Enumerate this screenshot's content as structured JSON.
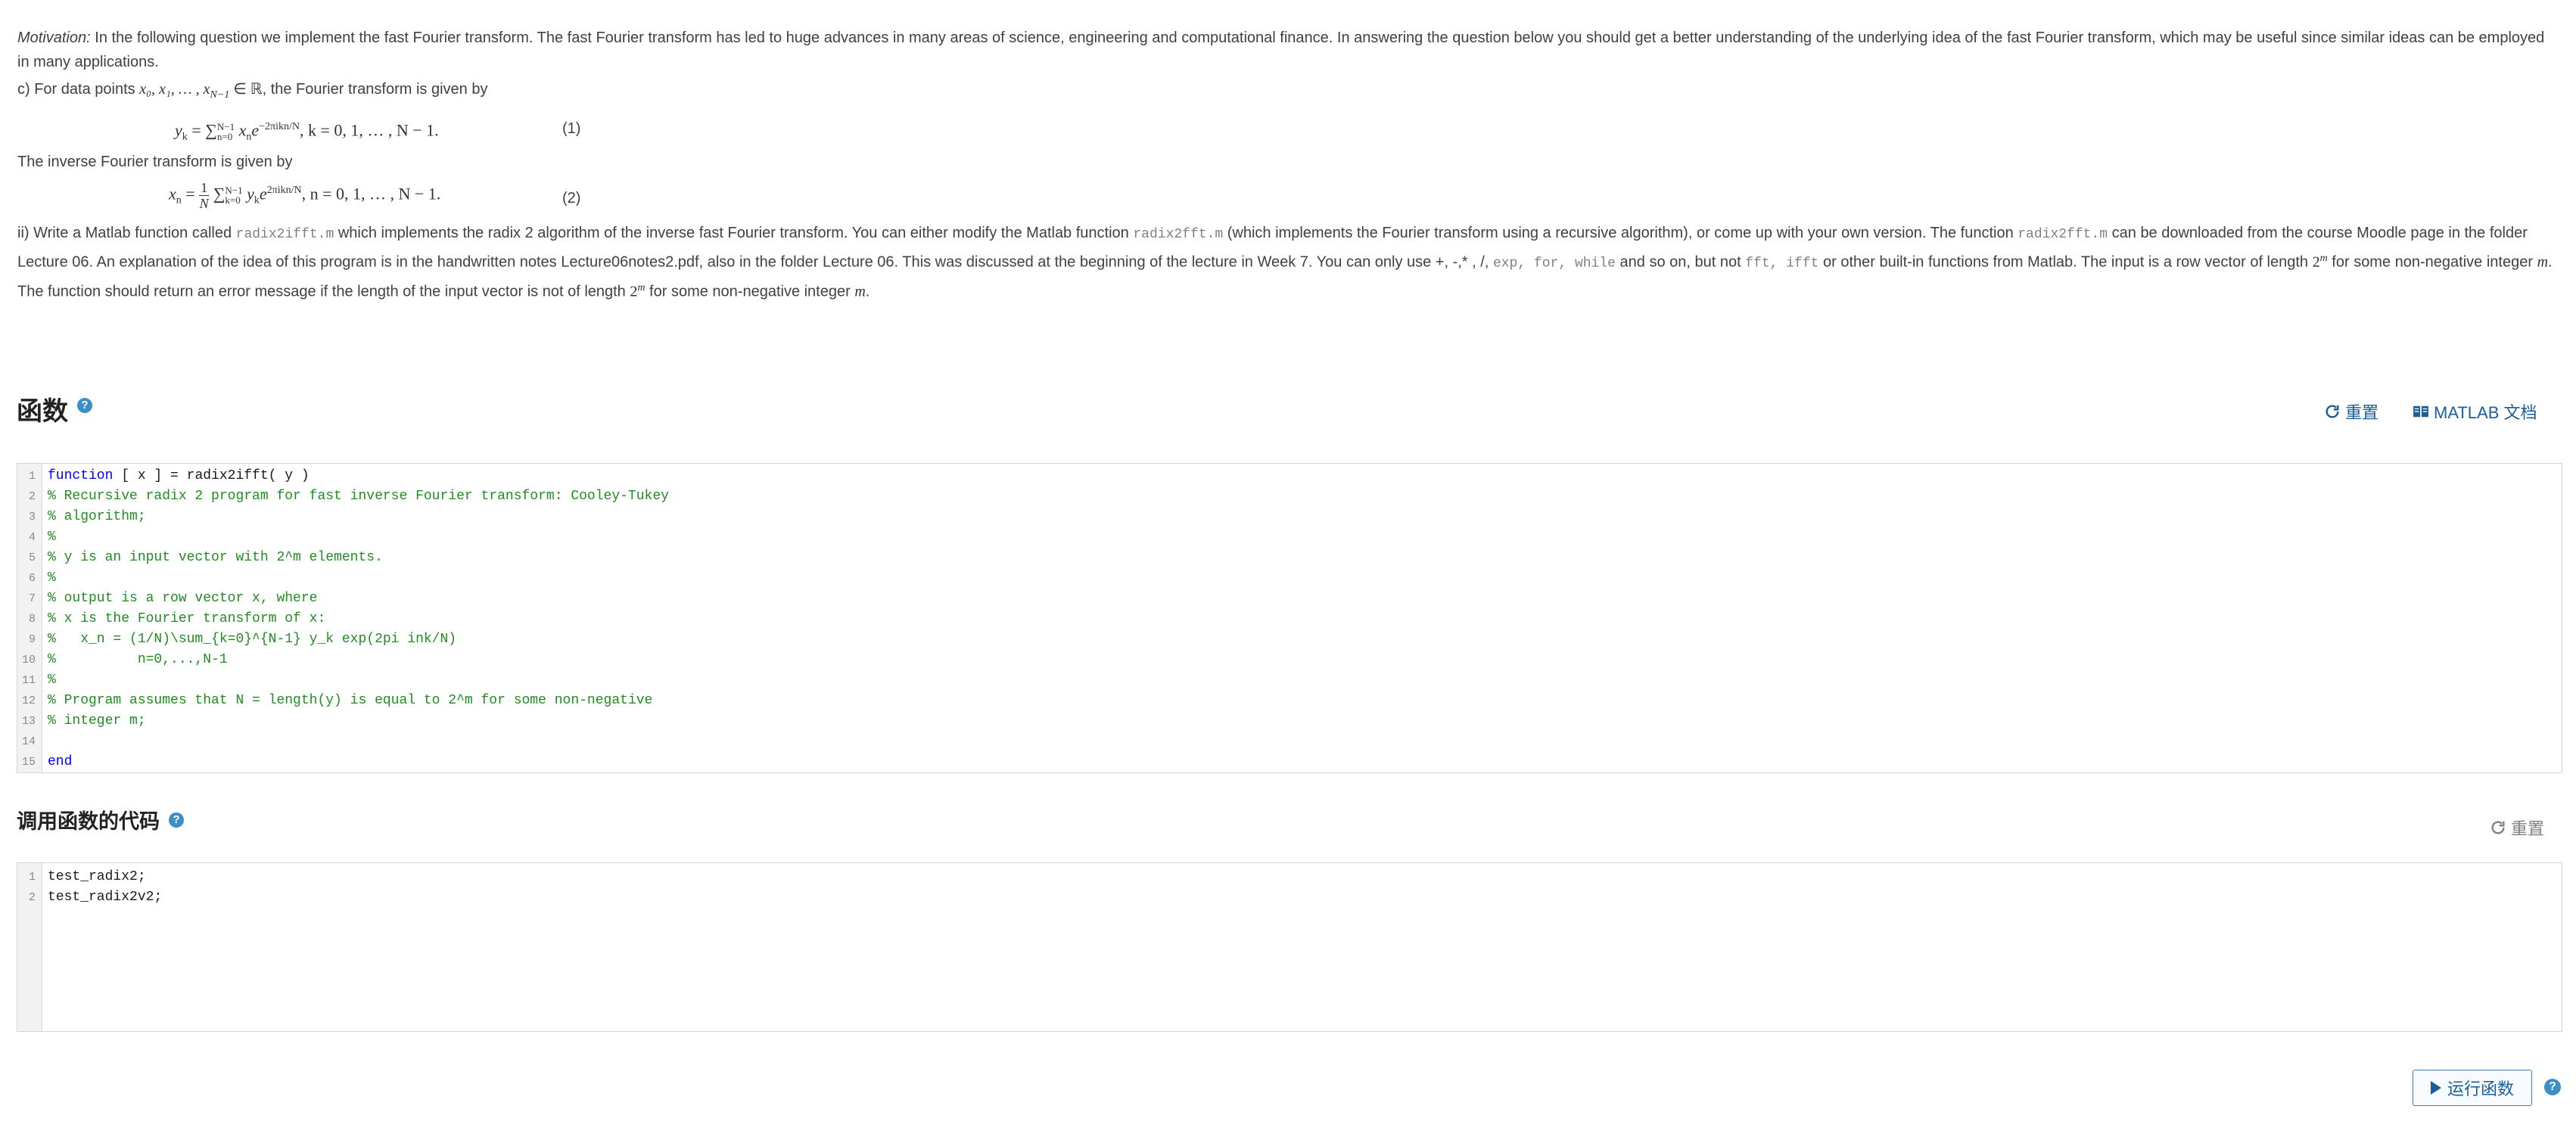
{
  "problem": {
    "motivation_label": "Motivation:",
    "motivation_text": " In the following question we implement the fast Fourier transform. The fast Fourier transform has led to huge advances in many areas of science, engineering and computational finance. In answering the question below you should get a better understanding of the underlying idea of the fast Fourier transform, which may be useful since similar ideas can be employed in many applications.",
    "part_c_intro": "c) For data points ",
    "part_c_points": "x₀, x₁, … , x",
    "part_c_points_sub": "N−1",
    "part_c_points_tail": " ∈ ℝ",
    "part_c_after": ", the Fourier transform is given by",
    "eq1_lhs": "y",
    "eq1_lhs_sub": "k",
    "eq1_rhs": " = ∑",
    "eq1_sum_sup": "N−1",
    "eq1_sum_sub": "n=0",
    "eq1_body": " x",
    "eq1_body_sub": "n",
    "eq1_exp_base": "e",
    "eq1_exp": "−2πikn/N",
    "eq1_range": ",   k = 0, 1, … , N − 1.",
    "eq1_number": "(1)",
    "inverse_intro": "The inverse Fourier transform is given by",
    "eq2_lhs": "x",
    "eq2_lhs_sub": "n",
    "eq2_frac_num": "1",
    "eq2_frac_den": "N",
    "eq2_sum_sup": "N−1",
    "eq2_sum_sub": "k=0",
    "eq2_body": " y",
    "eq2_body_sub": "k",
    "eq2_exp_base": "e",
    "eq2_exp": "2πikn/N",
    "eq2_range": ",   n = 0, 1, … , N − 1.",
    "eq2_number": "(2)",
    "part_ii_a": "ii) Write a Matlab function called ",
    "part_ii_fn": "radix2ifft.m",
    "part_ii_b": " which implements the radix 2 algorithm of the inverse fast Fourier transform. You can either modify the Matlab function ",
    "part_ii_fn2": "radix2fft.m",
    "part_ii_c": " (which implements the Fourier transform using a recursive algorithm), or come up with your own version. The function ",
    "part_ii_fn3": "radix2fft.m",
    "part_ii_d": " can be downloaded from the course Moodle page in the folder Lecture 06. An explanation of the idea of this program is in the handwritten notes Lecture06notes2.pdf, also in the folder Lecture 06. This was discussed at the beginning of the lecture in Week 7. You can only use +, -,* , /, ",
    "part_ii_allowed": "exp, for, while",
    "part_ii_e": " and so on, but not ",
    "part_ii_forbidden": "fft, ifft",
    "part_ii_f": " or other built-in functions from Matlab. The input is a row vector of length ",
    "part_ii_len": "2",
    "part_ii_len_sup": "m",
    "part_ii_g": " for some non-negative integer ",
    "part_ii_m": "m",
    "part_ii_h": ". The function should return an error message if the length of the input vector is not of length ",
    "part_ii_len2": "2",
    "part_ii_len2_sup": "m",
    "part_ii_i": " for some non-negative integer ",
    "part_ii_m2": "m",
    "part_ii_j": "."
  },
  "function_section": {
    "title": "函数",
    "help_icon": "?",
    "reset_label": "重置",
    "docs_label": "MATLAB 文档",
    "code_lines": [
      {
        "n": "1",
        "kw": "function",
        "text": " [ x ] = radix2ifft( y )",
        "type": "kw"
      },
      {
        "n": "2",
        "text": "% Recursive radix 2 program for fast inverse Fourier transform: Cooley-Tukey",
        "type": "comment"
      },
      {
        "n": "3",
        "text": "% algorithm;",
        "type": "comment"
      },
      {
        "n": "4",
        "text": "%",
        "type": "comment"
      },
      {
        "n": "5",
        "text": "% y is an input vector with 2^m elements.",
        "type": "comment"
      },
      {
        "n": "6",
        "text": "%",
        "type": "comment"
      },
      {
        "n": "7",
        "text": "% output is a row vector x, where",
        "type": "comment"
      },
      {
        "n": "8",
        "text": "% x is the Fourier transform of x:",
        "type": "comment"
      },
      {
        "n": "9",
        "text": "%   x_n = (1/N)\\sum_{k=0}^{N-1} y_k exp(2pi ink/N)",
        "type": "comment"
      },
      {
        "n": "10",
        "text": "%          n=0,...,N-1",
        "type": "comment"
      },
      {
        "n": "11",
        "text": "%",
        "type": "comment"
      },
      {
        "n": "12",
        "text": "% Program assumes that N = length(y) is equal to 2^m for some non-negative",
        "type": "comment"
      },
      {
        "n": "13",
        "text": "% integer m;",
        "type": "comment"
      },
      {
        "n": "14",
        "text": "",
        "type": "plain"
      },
      {
        "n": "15",
        "kw": "end",
        "text": "",
        "type": "kw"
      }
    ]
  },
  "call_section": {
    "title": "调用函数的代码",
    "help_icon": "?",
    "reset_label": "重置",
    "code_lines": [
      {
        "n": "1",
        "text": "test_radix2;"
      },
      {
        "n": "2",
        "text": "test_radix2v2;"
      }
    ]
  },
  "run": {
    "label": "运行函数",
    "help_icon": "?"
  },
  "colors": {
    "accent": "#3d8ec7",
    "link": "#1a5e9a",
    "keyword": "#0000ff",
    "comment": "#228b22"
  }
}
